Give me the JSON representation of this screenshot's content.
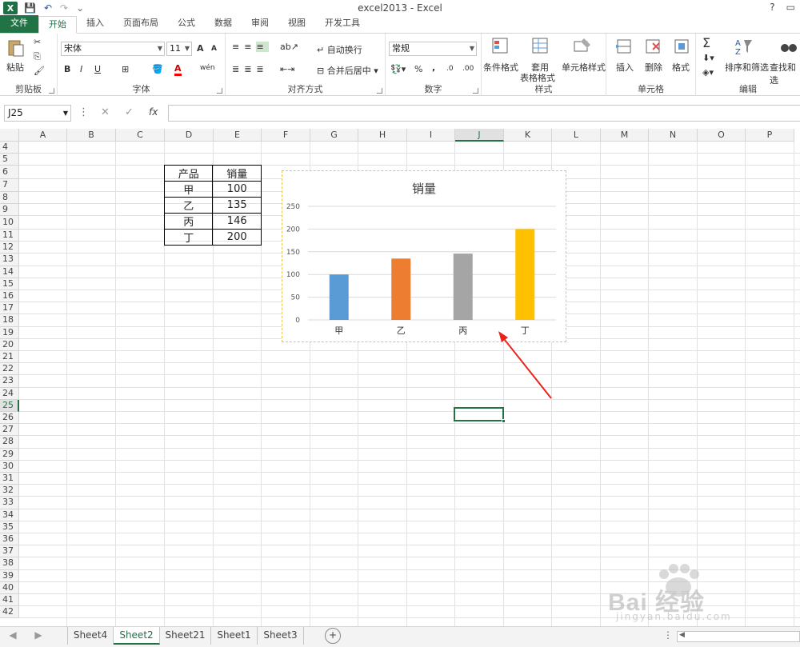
{
  "window": {
    "title": "excel2013 - Excel",
    "help": "?"
  },
  "tabs": [
    "文件",
    "开始",
    "插入",
    "页面布局",
    "公式",
    "数据",
    "审阅",
    "视图",
    "开发工具"
  ],
  "ribbon": {
    "clipboard": {
      "paste": "粘贴",
      "label": "剪贴板"
    },
    "font": {
      "name": "宋体",
      "size": "11",
      "bold": "B",
      "italic": "I",
      "underline": "U",
      "grow": "A",
      "shrink": "A",
      "font_color": "A",
      "phonetic": "wén",
      "label": "字体"
    },
    "alignment": {
      "wrap": "自动换行",
      "merge": "合并后居中",
      "label": "对齐方式"
    },
    "number": {
      "format": "常规",
      "percent": "%",
      "comma": ",",
      "inc": ".0",
      "dec": ".00",
      "label": "数字"
    },
    "styles": {
      "conditional": "条件格式",
      "table1": "套用",
      "table2": "表格格式",
      "cell_styles": "单元格样式",
      "label": "样式"
    },
    "cells": {
      "insert": "插入",
      "delete": "删除",
      "format": "格式",
      "label": "单元格"
    },
    "editing": {
      "sum": "Σ",
      "sort": "排序和筛选",
      "find": "查找和选",
      "label": "编辑"
    }
  },
  "formula_bar": {
    "name_box": "J25",
    "cancel": "✕",
    "enter": "✓",
    "fx": "fx",
    "value": ""
  },
  "columns": [
    "A",
    "B",
    "C",
    "D",
    "E",
    "F",
    "G",
    "H",
    "I",
    "J",
    "K",
    "L",
    "M",
    "N",
    "O",
    "P"
  ],
  "rows": [
    "4",
    "5",
    "6",
    "7",
    "8",
    "9",
    "10",
    "11",
    "12",
    "13",
    "14",
    "15",
    "16",
    "17",
    "18",
    "19",
    "20",
    "21",
    "22",
    "23",
    "24",
    "25",
    "26",
    "27",
    "28",
    "29",
    "30",
    "31",
    "32",
    "33",
    "34",
    "35",
    "36",
    "37",
    "38",
    "39",
    "40",
    "41",
    "42"
  ],
  "table": {
    "headers": [
      "产品",
      "销量"
    ],
    "rows": [
      [
        "甲",
        "100"
      ],
      [
        "乙",
        "135"
      ],
      [
        "丙",
        "146"
      ],
      [
        "丁",
        "200"
      ]
    ]
  },
  "chart_data": {
    "type": "bar",
    "title": "销量",
    "categories": [
      "甲",
      "乙",
      "丙",
      "丁"
    ],
    "values": [
      100,
      135,
      146,
      200
    ],
    "colors": [
      "#5b9bd5",
      "#ed7d31",
      "#a5a5a5",
      "#ffc000"
    ],
    "yticks": [
      "0",
      "50",
      "100",
      "150",
      "200",
      "250"
    ],
    "ylim": [
      0,
      250
    ],
    "xlabel": "",
    "ylabel": "",
    "grid": true,
    "legend": "none"
  },
  "sheets": [
    "Sheet4",
    "Sheet2",
    "Sheet21",
    "Sheet1",
    "Sheet3"
  ],
  "active_sheet": "Sheet2",
  "add_sheet": "+",
  "watermark": {
    "brand": "Bai 经验",
    "url": "jingyan.baidu.com"
  }
}
